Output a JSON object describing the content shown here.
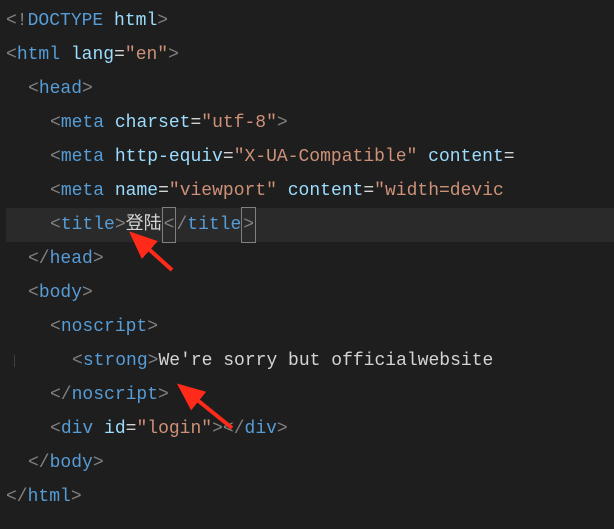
{
  "code": {
    "doctype": {
      "open": "<!",
      "name": "DOCTYPE",
      "attr": "html",
      "close": ">"
    },
    "html_open": {
      "ob": "<",
      "tag": "html",
      "attr": "lang",
      "eq": "=",
      "q": "\"",
      "val": "en",
      "cb": ">"
    },
    "head_open": {
      "ob": "<",
      "tag": "head",
      "cb": ">"
    },
    "meta1": {
      "ob": "<",
      "tag": "meta",
      "attr1": "charset",
      "eq": "=",
      "q": "\"",
      "val1": "utf-8",
      "cb": ">"
    },
    "meta2": {
      "ob": "<",
      "tag": "meta",
      "attr1": "http-equiv",
      "eq": "=",
      "q": "\"",
      "val1": "X-UA-Compatible",
      "attr2": "content"
    },
    "meta3": {
      "ob": "<",
      "tag": "meta",
      "attr1": "name",
      "eq": "=",
      "q": "\"",
      "val1": "viewport",
      "attr2": "content",
      "val2": "width=devic"
    },
    "title": {
      "ob": "<",
      "tag": "title",
      "cb": ">",
      "text": "登陆",
      "ob2": "<",
      "slash": "/",
      "cb2": ">"
    },
    "head_close": {
      "ob": "</",
      "tag": "head",
      "cb": ">"
    },
    "body_open": {
      "ob": "<",
      "tag": "body",
      "cb": ">"
    },
    "noscript_open": {
      "ob": "<",
      "tag": "noscript",
      "cb": ">"
    },
    "strong": {
      "ob": "<",
      "tag": "strong",
      "cb": ">",
      "text": "We're sorry but officialwebsite "
    },
    "noscript_close": {
      "ob": "</",
      "tag": "noscript",
      "cb": ">"
    },
    "div": {
      "ob": "<",
      "tag": "div",
      "attr": "id",
      "eq": "=",
      "q": "\"",
      "val": "login",
      "cb": ">",
      "ob2": "</",
      "cb2": ">"
    },
    "body_close": {
      "ob": "</",
      "tag": "body",
      "cb": ">"
    },
    "html_close": {
      "ob": "</",
      "tag": "html",
      "cb": ">"
    }
  }
}
